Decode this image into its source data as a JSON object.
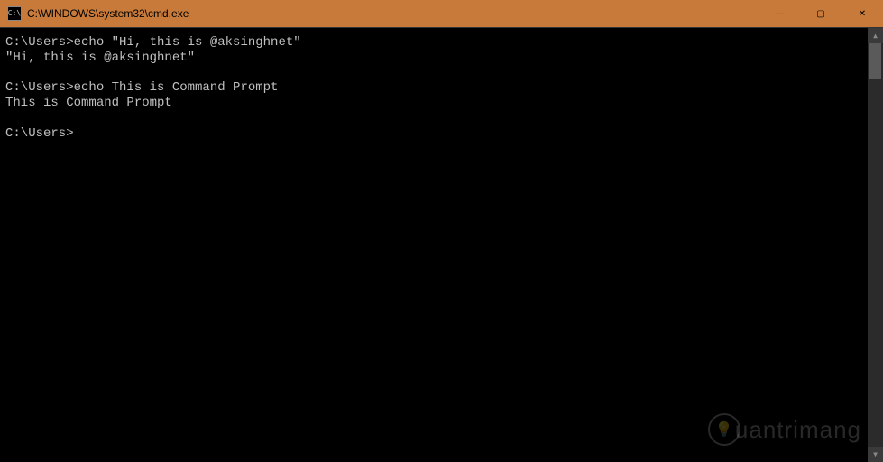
{
  "titlebar": {
    "icon_label": "C:\\",
    "title": "C:\\WINDOWS\\system32\\cmd.exe",
    "minimize": "—",
    "maximize": "▢",
    "close": "✕"
  },
  "terminal": {
    "lines": [
      "C:\\Users>echo \"Hi, this is @aksinghnet\"",
      "\"Hi, this is @aksinghnet\"",
      "",
      "C:\\Users>echo This is Command Prompt",
      "This is Command Prompt",
      "",
      "C:\\Users>"
    ]
  },
  "scrollbar": {
    "up": "▲",
    "down": "▼"
  },
  "watermark": {
    "icon": "💡",
    "text": "uantrimang"
  }
}
